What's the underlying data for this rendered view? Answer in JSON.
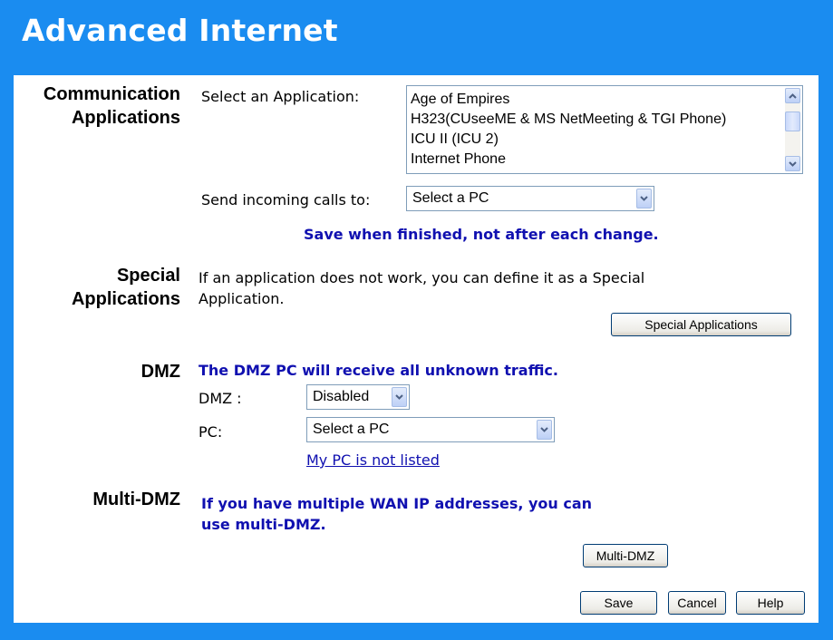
{
  "page": {
    "title": "Advanced Internet"
  },
  "communication": {
    "heading_line1": "Communication",
    "heading_line2": "Applications",
    "select_label": "Select an Application:",
    "applications": [
      "Age of Empires",
      "H323(CUseeME & MS NetMeeting & TGI Phone)",
      "ICU II (ICU 2)",
      "Internet Phone"
    ],
    "send_label": "Send incoming calls to:",
    "send_value": "Select a PC",
    "save_note": "Save when finished, not after each change."
  },
  "special": {
    "heading_line1": "Special",
    "heading_line2": "Applications",
    "description_line1": "If an application does not work, you can define it as a Special",
    "description_line2": "Application.",
    "button_label": "Special Applications"
  },
  "dmz": {
    "heading": "DMZ",
    "note": "The DMZ PC will receive all unknown traffic.",
    "dmz_label": "DMZ :",
    "dmz_value": "Disabled",
    "pc_label": "PC:",
    "pc_value": "Select a PC",
    "link_text": "My PC is not listed"
  },
  "multi_dmz": {
    "heading": "Multi-DMZ",
    "note_line1": "If you have multiple WAN IP addresses, you can",
    "note_line2": "use multi-DMZ.",
    "button_label": "Multi-DMZ"
  },
  "footer": {
    "save_label": "Save",
    "cancel_label": "Cancel",
    "help_label": "Help"
  },
  "colors": {
    "background": "#1a8cf0",
    "panel": "#ffffff",
    "note_text": "#1010b0"
  }
}
